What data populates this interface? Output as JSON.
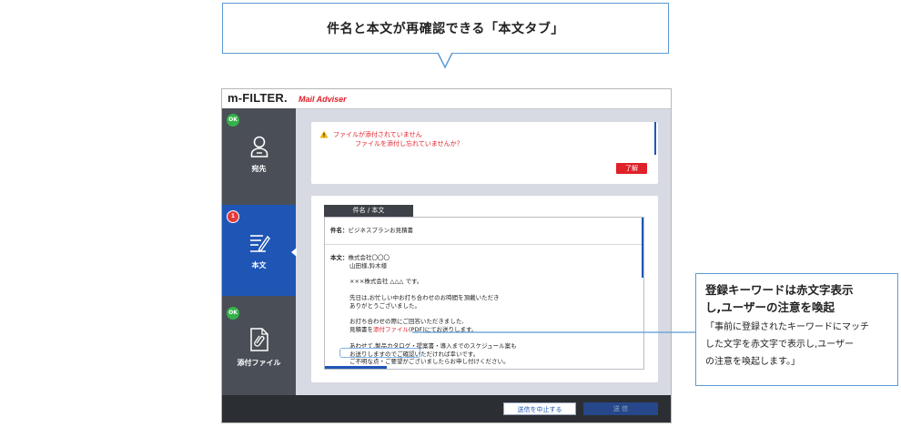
{
  "top_callout": {
    "text": "件名と本文が再確認できる「本文タブ」"
  },
  "app": {
    "logo": "m-FILTER.",
    "logo_sub": "Mail Adviser",
    "nav": [
      {
        "label": "宛先",
        "badge": "OK",
        "icon": "user-icon"
      },
      {
        "label": "本文",
        "badge": "1",
        "icon": "document-edit-icon",
        "active": true
      },
      {
        "label": "添付ファイル",
        "badge": "OK",
        "icon": "paperclip-file-icon"
      }
    ],
    "warning": {
      "line1": "ファイルが添付されていません",
      "line2": "ファイルを添付し忘れていませんか？",
      "ok_button": "了解"
    },
    "body_tab": {
      "tab_label": "件名 / 本文",
      "subject_label": "件名：",
      "subject_value": "ビジネスプランお見積書",
      "body_label": "本文：",
      "lines": [
        "株式会社〇〇〇",
        "山田様,鈴木様",
        "",
        "×××株式会社 △△△ です。",
        "",
        "先日は,お忙しい中お打ち合わせのお時間を頂戴いただき",
        "ありがとうございました。",
        "",
        "お打ち合わせの際にご回答いただきました,",
        "",
        "",
        "あわせて,製品カタログ・提案書・導入までのスケジュール案も",
        "お送りしますのでご確認いただければ幸いです。",
        "ご不明な点・ご要望がございましたらお申し付けください。"
      ],
      "kw_before": "見積書を",
      "keyword": "添付ファイル",
      "kw_after": "(PDF)にてお送りします。"
    },
    "footer": {
      "stop_button": "送信を中止する",
      "send_button": "送 信"
    }
  },
  "side_callout": {
    "title_line1": "登録キーワードは赤文字表示",
    "title_line2": "し,ユーザーの注意を喚起",
    "desc_line1": "「事前に登録されたキーワードにマッチ",
    "desc_line2": "した文字を赤文字で表示し,ユーザー",
    "desc_line3": "の注意を喚起します。」"
  },
  "colors": {
    "accent": "#1f56b6",
    "callout_border": "#5b9bd5",
    "keyword": "#e0202a",
    "ok": "#33b24a"
  }
}
